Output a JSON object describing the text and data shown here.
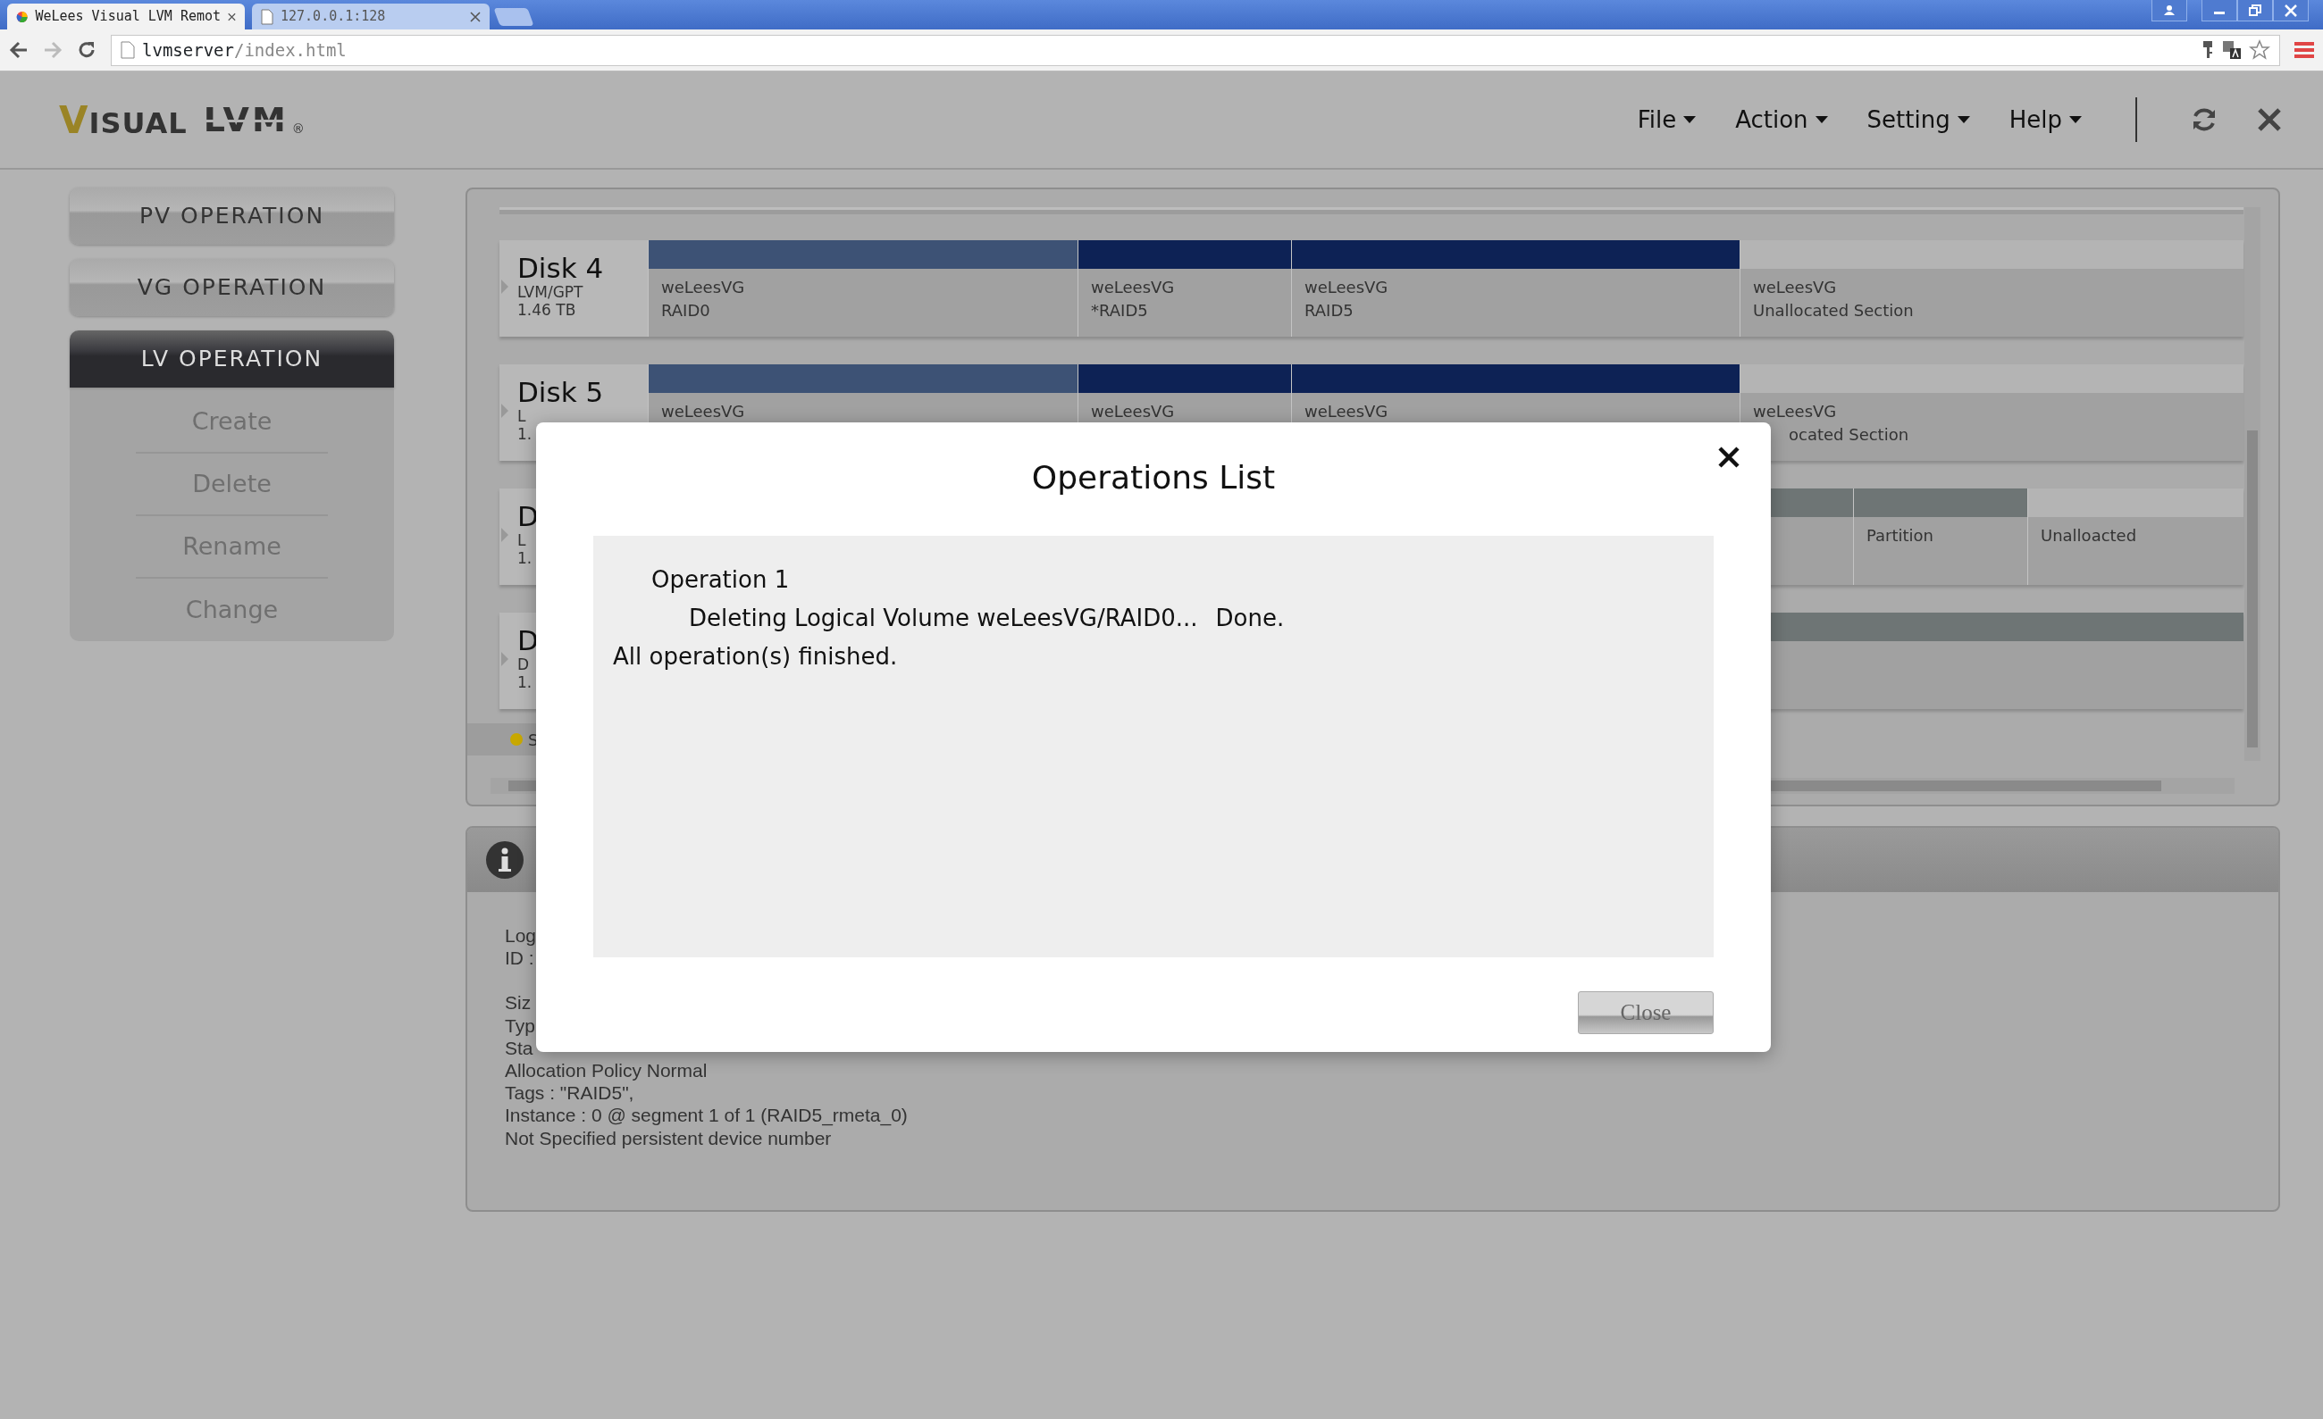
{
  "browser": {
    "tabs": [
      {
        "title": "WeLees Visual LVM Remot",
        "selected": true
      },
      {
        "title": "127.0.0.1:128",
        "selected": false
      }
    ],
    "address": {
      "host": "lvmserver",
      "path": "/index.html"
    }
  },
  "header": {
    "logo": {
      "first": "VISUAL",
      "second": "LVM",
      "mark": "®"
    },
    "menu": [
      {
        "label": "File"
      },
      {
        "label": "Action"
      },
      {
        "label": "Setting"
      },
      {
        "label": "Help"
      }
    ]
  },
  "sidebar": {
    "sections": [
      {
        "label": "PV OPERATION",
        "selected": false
      },
      {
        "label": "VG OPERATION",
        "selected": false
      },
      {
        "label": "LV OPERATION",
        "selected": true,
        "items": [
          "Create",
          "Delete",
          "Rename",
          "Change"
        ]
      }
    ]
  },
  "disks": [
    {
      "name": "Disk 4",
      "lines": [
        "LVM/GPT",
        "1.46 TB"
      ],
      "segments": [
        {
          "color": "#3d5275",
          "lines": [
            "weLeesVG",
            "RAID0"
          ]
        },
        {
          "color": "#0d2255",
          "lines": [
            "weLeesVG",
            "*RAID5"
          ]
        },
        {
          "color": "#0d2255",
          "lines": [
            "weLeesVG",
            "RAID5"
          ]
        },
        {
          "color": "#b4b4b4",
          "lines": [
            "weLeesVG",
            "Unallocated Section"
          ]
        }
      ]
    },
    {
      "name": "Disk 5",
      "lines": [
        "L",
        "1."
      ],
      "segments": [
        {
          "color": "#3d5275",
          "lines": [
            "weLeesVG"
          ]
        },
        {
          "color": "#0d2255",
          "lines": [
            "weLeesVG"
          ]
        },
        {
          "color": "#0d2255",
          "lines": [
            "weLeesVG"
          ]
        },
        {
          "color": "#b4b4b4",
          "lines": [
            "weLeesVG",
            "ocated Section"
          ]
        }
      ]
    },
    {
      "name": "D",
      "lines": [
        "L",
        "1."
      ],
      "segments": [
        {
          "color": "#6e7575"
        },
        {
          "color": "#6e7575",
          "lines": [
            "Partition"
          ]
        },
        {
          "color": "#b4b4b4",
          "lines": [
            "Unalloacted"
          ]
        }
      ]
    },
    {
      "name": "D",
      "lines": [
        "D",
        "1."
      ],
      "segments": [
        {
          "color": "#6e7575"
        }
      ]
    }
  ],
  "legend": [
    {
      "color": "#c8a800",
      "label": "S"
    }
  ],
  "info": {
    "groups": [
      [
        "Log",
        "ID :"
      ],
      [
        "Siz",
        "Typ",
        "Sta",
        "Allocation Policy Normal",
        "Tags : \"RAID5\",",
        "Instance : 0 @ segment 1 of 1 (RAID5_rmeta_0)",
        "Not Specified persistent device number"
      ]
    ]
  },
  "dialog": {
    "title": "Operations List",
    "operations": [
      {
        "title": "Operation 1",
        "steps": [
          {
            "text": "Deleting Logical Volume weLeesVG/RAID0...",
            "result": "Done."
          }
        ]
      }
    ],
    "summary": "All operation(s) finished.",
    "button": "Close"
  }
}
